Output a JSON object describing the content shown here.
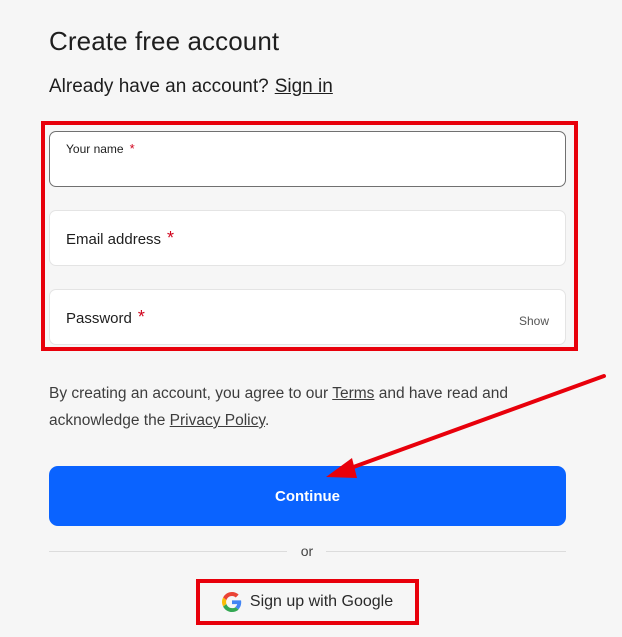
{
  "header": {
    "title": "Create free account",
    "already_text": "Already have an account?",
    "signin_link": "Sign in"
  },
  "form": {
    "name_label": "Your name",
    "email_label": "Email address",
    "password_label": "Password",
    "required_mark": "*",
    "show_label": "Show"
  },
  "terms": {
    "prefix": "By creating an account, you agree to our",
    "terms_link": "Terms",
    "middle": "and have read and acknowledge the",
    "privacy_link": "Privacy Policy",
    "suffix": "."
  },
  "actions": {
    "continue_label": "Continue",
    "or_text": "or",
    "google_label": "Sign up with Google"
  },
  "colors": {
    "primary": "#0a63ff",
    "annotation": "#e8000b",
    "required": "#d0021b"
  },
  "icons": {
    "google": "google-g-icon"
  }
}
